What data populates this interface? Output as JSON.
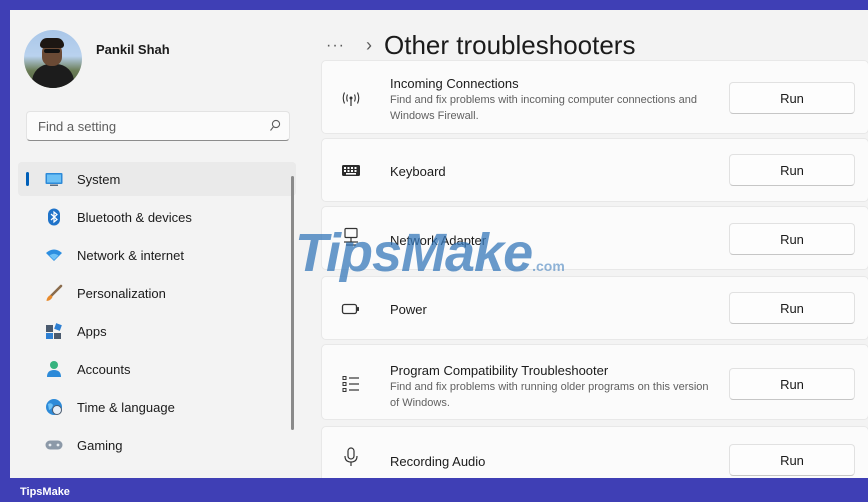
{
  "profile": {
    "name": "Pankil Shah"
  },
  "search": {
    "placeholder": "Find a setting"
  },
  "nav": [
    {
      "label": "System",
      "icon": "monitor-icon",
      "selected": true
    },
    {
      "label": "Bluetooth & devices",
      "icon": "bluetooth-icon"
    },
    {
      "label": "Network & internet",
      "icon": "wifi-icon"
    },
    {
      "label": "Personalization",
      "icon": "brush-icon"
    },
    {
      "label": "Apps",
      "icon": "apps-icon"
    },
    {
      "label": "Accounts",
      "icon": "person-icon"
    },
    {
      "label": "Time & language",
      "icon": "globe-clock-icon"
    },
    {
      "label": "Gaming",
      "icon": "gamepad-icon"
    }
  ],
  "header": {
    "more": "···",
    "chevron": "›",
    "title": "Other troubleshooters"
  },
  "troubleshooters": [
    {
      "title": "Incoming Connections",
      "description": "Find and fix problems with incoming computer connections and Windows Firewall.",
      "icon": "antenna-icon",
      "button": "Run"
    },
    {
      "title": "Keyboard",
      "description": "",
      "icon": "keyboard-icon",
      "button": "Run"
    },
    {
      "title": "Network Adapter",
      "description": "",
      "icon": "network-adapter-icon",
      "button": "Run"
    },
    {
      "title": "Power",
      "description": "",
      "icon": "battery-icon",
      "button": "Run"
    },
    {
      "title": "Program Compatibility Troubleshooter",
      "description": "Find and fix problems with running older programs on this version of Windows.",
      "icon": "list-icon",
      "button": "Run"
    },
    {
      "title": "Recording Audio",
      "description": "",
      "icon": "microphone-icon",
      "button": "Run"
    }
  ],
  "watermark": {
    "main": "TipsMake",
    "sub": ".com"
  },
  "footer": {
    "brand": "TipsMake"
  },
  "colors": {
    "accent": "#005fb8",
    "frame": "#3f3fb5",
    "background": "#f3f3f3",
    "card": "#fbfbfb"
  }
}
